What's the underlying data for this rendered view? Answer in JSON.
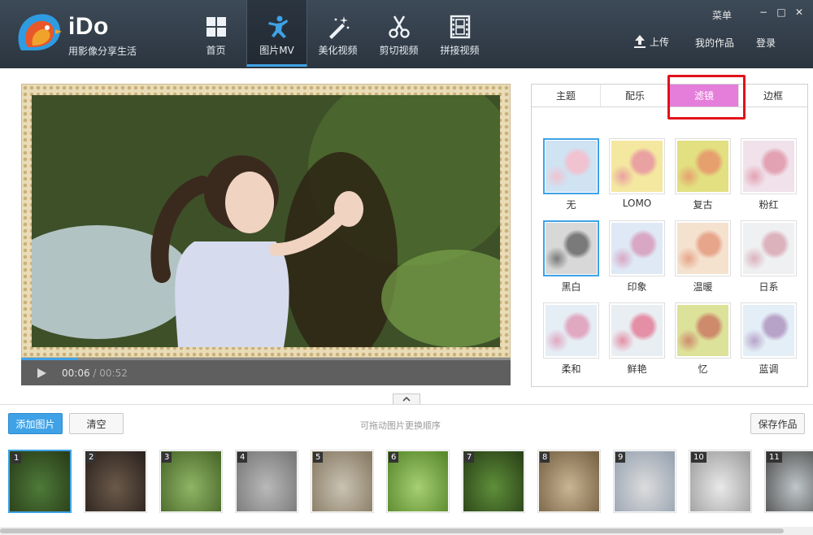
{
  "app": {
    "title": "iDo",
    "slogan": "用影像分享生活"
  },
  "nav": [
    {
      "label": "首页",
      "icon": "grid-icon"
    },
    {
      "label": "图片MV",
      "icon": "dancer-icon",
      "active": true
    },
    {
      "label": "美化视频",
      "icon": "magic-wand-icon"
    },
    {
      "label": "剪切视频",
      "icon": "scissors-icon"
    },
    {
      "label": "拼接视频",
      "icon": "film-icon"
    }
  ],
  "window": {
    "menu_label": "菜单",
    "minimize": "−",
    "maximize": "□",
    "close": "✕"
  },
  "account": {
    "upload_label": "上传",
    "my_works_label": "我的作品",
    "login_label": "登录"
  },
  "player": {
    "current_time": "00:06",
    "separator": " / ",
    "total_time": "00:52",
    "progress": 0.115
  },
  "panel": {
    "tabs": [
      {
        "label": "主题"
      },
      {
        "label": "配乐"
      },
      {
        "label": "滤镜",
        "active": true
      },
      {
        "label": "边框"
      }
    ],
    "filters": [
      {
        "label": "无",
        "selected": true,
        "tone": [
          "#cfe3f3",
          "#f1c2d0"
        ]
      },
      {
        "label": "LOMO",
        "tone": [
          "#f4e7a0",
          "#e9a1a1"
        ]
      },
      {
        "label": "复古",
        "tone": [
          "#e2e081",
          "#e6a06e"
        ]
      },
      {
        "label": "粉红",
        "tone": [
          "#f0e1ea",
          "#e3a2b3"
        ]
      },
      {
        "label": "黑白",
        "selected": true,
        "tone": [
          "#d8d8d8",
          "#7a7a7a"
        ]
      },
      {
        "label": "印象",
        "tone": [
          "#dfe9f6",
          "#d8a7c4"
        ]
      },
      {
        "label": "温暖",
        "tone": [
          "#f4e2cf",
          "#e7a58a"
        ]
      },
      {
        "label": "日系",
        "tone": [
          "#eef0f1",
          "#dcb2bd"
        ]
      },
      {
        "label": "柔和",
        "tone": [
          "#e5edf5",
          "#e1a8c2"
        ]
      },
      {
        "label": "鲜艳",
        "tone": [
          "#e9eef3",
          "#e48fa6"
        ]
      },
      {
        "label": "忆",
        "tone": [
          "#dde29a",
          "#cd8b6c"
        ]
      },
      {
        "label": "蓝调",
        "tone": [
          "#e3eef7",
          "#b8a3c8"
        ]
      }
    ]
  },
  "bottom": {
    "add_label": "添加图片",
    "clear_label": "清空",
    "hint": "可拖动图片更换顺序",
    "save_label": "保存作品"
  },
  "thumbnails": [
    {
      "num": "1",
      "selected": true,
      "tone": [
        "#4e7a3a",
        "#2b4019"
      ]
    },
    {
      "num": "2",
      "tone": [
        "#6b5a4a",
        "#2f2520"
      ]
    },
    {
      "num": "3",
      "tone": [
        "#8fb566",
        "#4c6b2c"
      ]
    },
    {
      "num": "4",
      "tone": [
        "#b9b9b9",
        "#7a7a7a"
      ]
    },
    {
      "num": "5",
      "tone": [
        "#c9c2b3",
        "#8a7d66"
      ]
    },
    {
      "num": "6",
      "tone": [
        "#a7cf73",
        "#5b8a2e"
      ]
    },
    {
      "num": "7",
      "tone": [
        "#5f8f3a",
        "#2c4519"
      ]
    },
    {
      "num": "8",
      "tone": [
        "#c9b592",
        "#7a6648"
      ]
    },
    {
      "num": "9",
      "tone": [
        "#dcdcdc",
        "#9aa5b3"
      ]
    },
    {
      "num": "10",
      "tone": [
        "#e9e9e9",
        "#a0a0a0"
      ]
    },
    {
      "num": "11",
      "tone": [
        "#bfc6c9",
        "#555555"
      ]
    }
  ]
}
